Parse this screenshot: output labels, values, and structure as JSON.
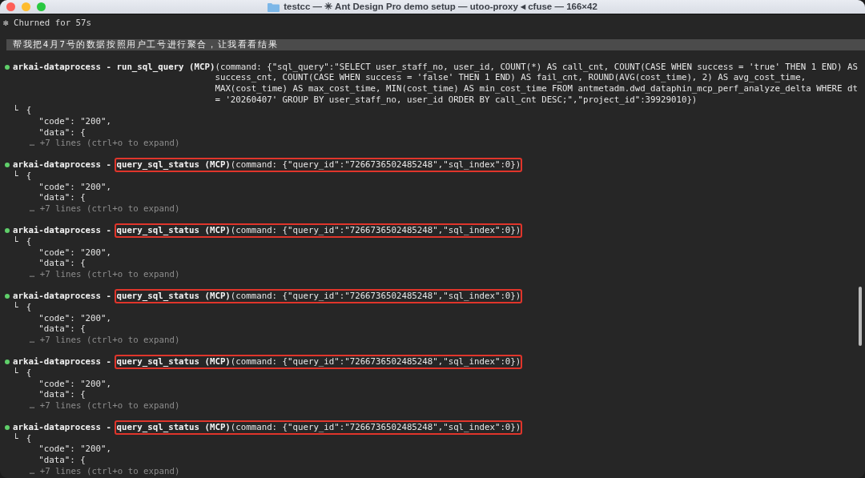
{
  "window": {
    "title": "testcc — ✳ Ant Design Pro demo setup — utoo-proxy ◂ cfuse — 166×42"
  },
  "status_line": {
    "glyph": "✻",
    "text": "Churned for 57s"
  },
  "prompt": "帮我把4月7号的数据按照用户工号进行聚合，让我看看结果",
  "calls": [
    {
      "color": "#5fcf6a",
      "server": "arkai-dataprocess",
      "separator": "-",
      "tool": "run_sql_query (MCP)",
      "highlighted": false,
      "command_lines": [
        "(command: {\"sql_query\":\"SELECT user_staff_no, user_id, COUNT(*) AS call_cnt, COUNT(CASE WHEN success = 'true' THEN 1 END) AS",
        "success_cnt, COUNT(CASE WHEN success = 'false' THEN 1 END) AS fail_cnt, ROUND(AVG(cost_time), 2) AS avg_cost_time,",
        "MAX(cost_time) AS max_cost_time, MIN(cost_time) AS min_cost_time FROM antmetadm.dwd_dataphin_mcp_perf_analyze_delta WHERE dt",
        "= '20260407' GROUP BY user_staff_no, user_id ORDER BY call_cnt DESC;\",\"project_id\":39929010})"
      ],
      "output": {
        "branch": "└",
        "lines": [
          "{",
          "\"code\": \"200\",",
          "\"data\": {"
        ],
        "ellipsis": "…",
        "more": "+7 lines (ctrl+o to expand)"
      }
    },
    {
      "color": "#5fcf6a",
      "server": "arkai-dataprocess",
      "separator": "-",
      "tool": "query_sql_status (MCP)",
      "highlighted": true,
      "command_lines": [
        "(command: {\"query_id\":\"7266736502485248\",\"sql_index\":0})"
      ],
      "output": {
        "branch": "└",
        "lines": [
          "{",
          "\"code\": \"200\",",
          "\"data\": {"
        ],
        "ellipsis": "…",
        "more": "+7 lines (ctrl+o to expand)"
      }
    },
    {
      "color": "#5fcf6a",
      "server": "arkai-dataprocess",
      "separator": "-",
      "tool": "query_sql_status (MCP)",
      "highlighted": true,
      "command_lines": [
        "(command: {\"query_id\":\"7266736502485248\",\"sql_index\":0})"
      ],
      "output": {
        "branch": "└",
        "lines": [
          "{",
          "\"code\": \"200\",",
          "\"data\": {"
        ],
        "ellipsis": "…",
        "more": "+7 lines (ctrl+o to expand)"
      }
    },
    {
      "color": "#5fcf6a",
      "server": "arkai-dataprocess",
      "separator": "-",
      "tool": "query_sql_status (MCP)",
      "highlighted": true,
      "command_lines": [
        "(command: {\"query_id\":\"7266736502485248\",\"sql_index\":0})"
      ],
      "output": {
        "branch": "└",
        "lines": [
          "{",
          "\"code\": \"200\",",
          "\"data\": {"
        ],
        "ellipsis": "…",
        "more": "+7 lines (ctrl+o to expand)"
      }
    },
    {
      "color": "#5fcf6a",
      "server": "arkai-dataprocess",
      "separator": "-",
      "tool": "query_sql_status (MCP)",
      "highlighted": true,
      "command_lines": [
        "(command: {\"query_id\":\"7266736502485248\",\"sql_index\":0})"
      ],
      "output": {
        "branch": "└",
        "lines": [
          "{",
          "\"code\": \"200\",",
          "\"data\": {"
        ],
        "ellipsis": "…",
        "more": "+7 lines (ctrl+o to expand)"
      }
    },
    {
      "color": "#5fcf6a",
      "server": "arkai-dataprocess",
      "separator": "-",
      "tool": "query_sql_status (MCP)",
      "highlighted": true,
      "command_lines": [
        "(command: {\"query_id\":\"7266736502485248\",\"sql_index\":0})"
      ],
      "output": {
        "branch": "└",
        "lines": [
          "{",
          "\"code\": \"200\",",
          "\"data\": {"
        ],
        "ellipsis": "…",
        "more": "+7 lines (ctrl+o to expand)"
      }
    }
  ]
}
